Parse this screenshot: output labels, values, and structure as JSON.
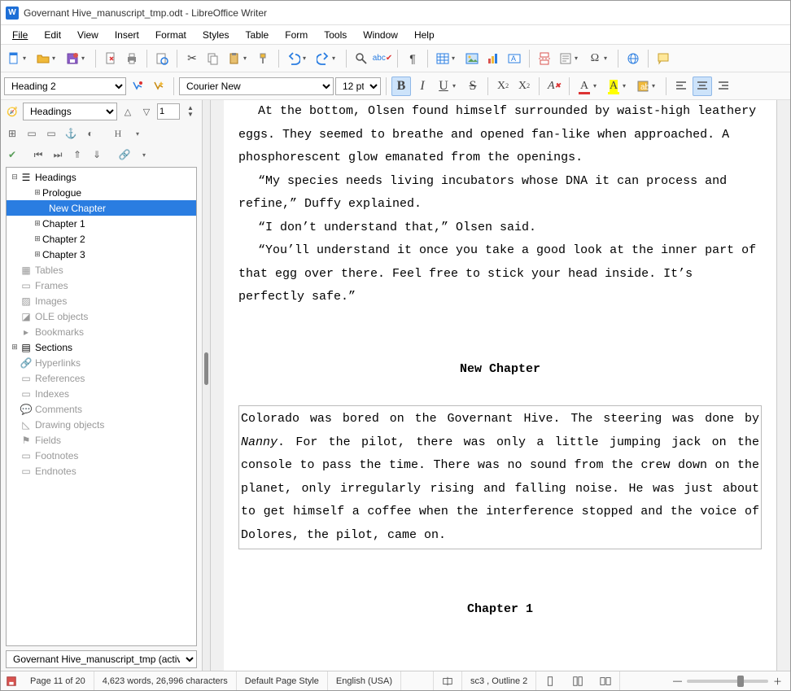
{
  "title": "Governant Hive_manuscript_tmp.odt - LibreOffice Writer",
  "menus": [
    "File",
    "Edit",
    "View",
    "Insert",
    "Format",
    "Styles",
    "Table",
    "Form",
    "Tools",
    "Window",
    "Help"
  ],
  "toolbar2": {
    "para_style": "Heading 2",
    "font_name": "Courier New",
    "font_size": "12 pt"
  },
  "navigator": {
    "mode": "Headings",
    "page_number": "1",
    "tree": {
      "headings": "Headings",
      "prologue": "Prologue",
      "new_chapter": "New Chapter",
      "chapter1": "Chapter 1",
      "chapter2": "Chapter 2",
      "chapter3": "Chapter 3",
      "tables": "Tables",
      "frames": "Frames",
      "images": "Images",
      "ole": "OLE objects",
      "bookmarks": "Bookmarks",
      "sections": "Sections",
      "hyperlinks": "Hyperlinks",
      "references": "References",
      "indexes": "Indexes",
      "comments": "Comments",
      "drawing": "Drawing objects",
      "fields": "Fields",
      "footnotes": "Footnotes",
      "endnotes": "Endnotes"
    },
    "active_doc": "Governant Hive_manuscript_tmp (active)"
  },
  "document": {
    "p1": "At the bottom, Olsen found himself surrounded by waist-high leathery eggs. They seemed to breathe and opened fan-like when approached. A phosphorescent glow emanated from the openings.",
    "p2": "“My species needs living incubators whose DNA it can process and refine,” Duffy explained.",
    "p3": "“I don’t understand that,” Olsen said.",
    "p4": "“You’ll understand it once you take a good look at the inner part of that egg over there. Feel free to stick your head inside. It’s perfectly safe.”",
    "h_new_chapter": "New Chapter",
    "p5a": "Colorado was bored on the Governant Hive. The steering was done by ",
    "p5b": "Nanny",
    "p5c": ". For the pilot, there was only a little jumping jack on the console to pass the time. There was no sound from the crew down on the planet, only irregularly rising and falling noise. He was just about to get himself a coffee when the interference stopped and the voice of Dolores, the pilot, came on.",
    "h_chapter1": "Chapter 1"
  },
  "status": {
    "page": "Page 11 of 20",
    "words": "4,623 words, 26,996 characters",
    "page_style": "Default Page Style",
    "language": "English (USA)",
    "selection": "sc3 , Outline 2"
  }
}
